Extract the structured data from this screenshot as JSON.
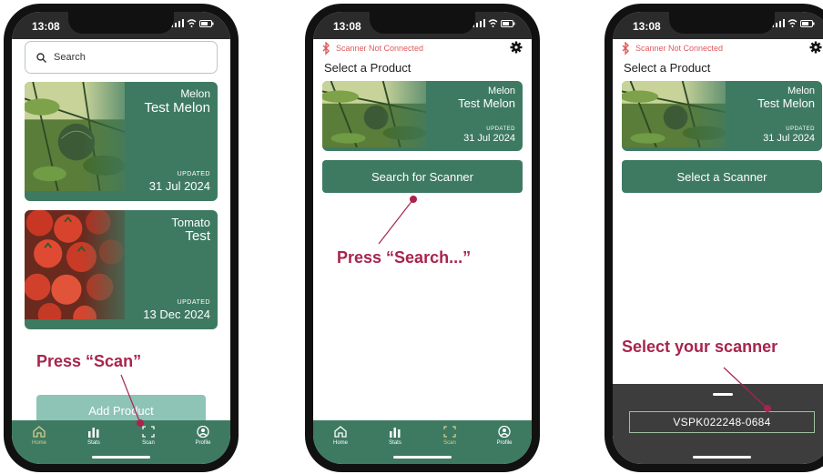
{
  "phone1": {
    "time": "13:08",
    "search_placeholder": "Search",
    "cards": [
      {
        "crop": "Melon",
        "name": "Test Melon",
        "updated_label": "UPDATED",
        "updated": "31 Jul 2024"
      },
      {
        "crop": "Tomato",
        "name": "Test",
        "updated_label": "UPDATED",
        "updated": "13 Dec 2024"
      }
    ],
    "add_button": "Add Product",
    "annotation": "Press “Scan”"
  },
  "phone2": {
    "time": "13:08",
    "connection": "Scanner Not Connected",
    "section_title": "Select a Product",
    "card": {
      "crop": "Melon",
      "name": "Test Melon",
      "updated_label": "UPDATED",
      "updated": "31 Jul 2024"
    },
    "action_button": "Search for Scanner",
    "annotation": "Press “Search...”"
  },
  "phone3": {
    "time": "13:08",
    "connection": "Scanner Not Connected",
    "section_title": "Select a Product",
    "card": {
      "crop": "Melon",
      "name": "Test Melon",
      "updated_label": "UPDATED",
      "updated": "31 Jul 2024"
    },
    "action_button": "Select a Scanner",
    "scanner_id": "VSPK022248-0684",
    "annotation": "Select your scanner"
  },
  "tabs": [
    {
      "label": "Home",
      "icon": "home-icon"
    },
    {
      "label": "Stats",
      "icon": "stats-icon"
    },
    {
      "label": "Scan",
      "icon": "scan-icon"
    },
    {
      "label": "Profile",
      "icon": "profile-icon"
    }
  ],
  "colors": {
    "brand_green": "#3e7a62",
    "annotation": "#a8244d",
    "warning": "#e05a5a",
    "active_tab": "#d5cd8a"
  }
}
